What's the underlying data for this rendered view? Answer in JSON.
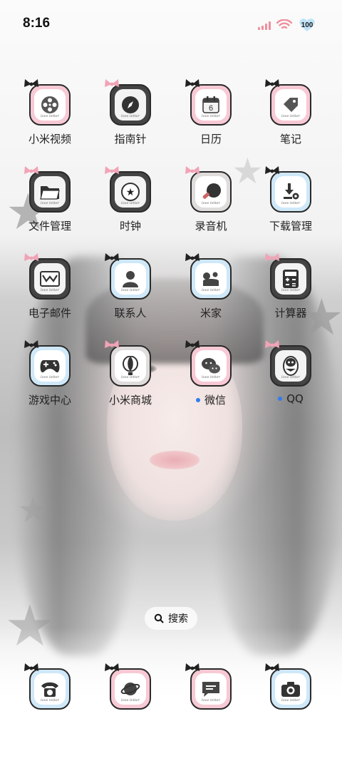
{
  "status_bar": {
    "time": "8:16",
    "battery": "100",
    "icons": [
      "signal-icon",
      "wifi-icon",
      "battery-heart-icon"
    ],
    "accent_color": "#f08e9c"
  },
  "apps": [
    {
      "label": "小米视频",
      "icon": "film-reel-icon",
      "bow": "black",
      "tile": "pink",
      "dot": false
    },
    {
      "label": "指南针",
      "icon": "compass-icon",
      "bow": "pink",
      "tile": "dark",
      "dot": false
    },
    {
      "label": "日历",
      "icon": "calendar-icon",
      "bow": "black",
      "tile": "pink",
      "dot": false,
      "glyph": "6"
    },
    {
      "label": "笔记",
      "icon": "tag-icon",
      "bow": "black",
      "tile": "pink",
      "dot": false
    },
    {
      "label": "文件管理",
      "icon": "folder-icon",
      "bow": "pink",
      "tile": "dark",
      "dot": false
    },
    {
      "label": "时钟",
      "icon": "clock-star-icon",
      "bow": "pink",
      "tile": "dark",
      "dot": false
    },
    {
      "label": "录音机",
      "icon": "record-icon",
      "bow": "pink",
      "tile": "gray",
      "dot": false
    },
    {
      "label": "下载管理",
      "icon": "download-settings-icon",
      "bow": "black",
      "tile": "blue",
      "dot": false
    },
    {
      "label": "电子邮件",
      "icon": "mail-icon",
      "bow": "pink",
      "tile": "dark",
      "dot": false
    },
    {
      "label": "联系人",
      "icon": "contact-icon",
      "bow": "black",
      "tile": "blue",
      "dot": false
    },
    {
      "label": "米家",
      "icon": "home-devices-icon",
      "bow": "black",
      "tile": "blue",
      "dot": false
    },
    {
      "label": "计算器",
      "icon": "calculator-icon",
      "bow": "pink",
      "tile": "dark",
      "dot": false
    },
    {
      "label": "游戏中心",
      "icon": "gamepad-icon",
      "bow": "black",
      "tile": "blue",
      "dot": false
    },
    {
      "label": "小米商城",
      "icon": "balloon-icon",
      "bow": "pink",
      "tile": "gray",
      "dot": false
    },
    {
      "label": "微信",
      "icon": "wechat-icon",
      "bow": "black",
      "tile": "pink",
      "dot": true
    },
    {
      "label": "QQ",
      "icon": "penguin-icon",
      "bow": "pink",
      "tile": "dark",
      "dot": true
    }
  ],
  "search": {
    "label": "搜索"
  },
  "dock": [
    {
      "icon": "phone-icon",
      "bow": "black",
      "tile": "blue"
    },
    {
      "icon": "browser-planet-icon",
      "bow": "black",
      "tile": "pink"
    },
    {
      "icon": "message-icon",
      "bow": "black",
      "tile": "pink"
    },
    {
      "icon": "camera-icon",
      "bow": "black",
      "tile": "blue"
    }
  ],
  "tagline": "love letter",
  "dot_color": "#2f7cf0"
}
